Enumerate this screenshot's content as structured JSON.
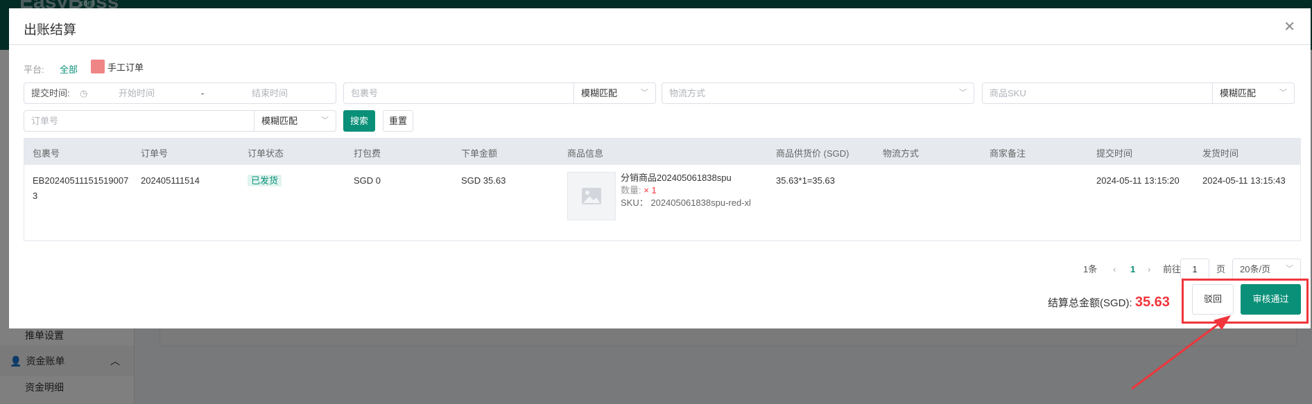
{
  "background": {
    "logo": "EasyBoss",
    "logo_suffix": ".com",
    "sidebar": [
      {
        "label": "推单设置"
      },
      {
        "label": "资金账单",
        "icon": "user-icon",
        "expanded": true
      },
      {
        "label": "资金明细"
      }
    ]
  },
  "modal": {
    "title": "出账结算",
    "close_icon": "close-icon",
    "platform": {
      "label": "平台:",
      "options": [
        "全部",
        "手工订单"
      ],
      "selected": "全部"
    },
    "filters": {
      "submit_time_label": "提交时间:",
      "start_placeholder": "开始时间",
      "range_sep": "-",
      "end_placeholder": "结束时间",
      "package_placeholder": "包裹号",
      "package_match": "模糊匹配",
      "logistics_placeholder": "物流方式",
      "sku_placeholder": "商品SKU",
      "sku_match": "模糊匹配",
      "order_placeholder": "订单号",
      "order_match": "模糊匹配",
      "search": "搜索",
      "reset": "重置"
    },
    "table": {
      "columns": [
        "包裹号",
        "订单号",
        "订单状态",
        "打包费",
        "下单金额",
        "商品信息",
        "商品供货价 (SGD)",
        "物流方式",
        "商家备注",
        "提交时间",
        "发货时间"
      ],
      "rows": [
        {
          "package_no": "EB202405111515190073",
          "order_no": "202405111514",
          "status": "已发货",
          "packing_fee": "SGD 0",
          "order_amount": "SGD 35.63",
          "product_name": "分销商品202405061838spu",
          "qty_label": "数量:",
          "qty": "× 1",
          "sku_label": "SKU：",
          "sku": "202405061838spu-red-xl",
          "supply_price": "35.63*1=35.63",
          "logistics": "",
          "remark": "",
          "submit_time": "2024-05-11 13:15:20",
          "ship_time": "2024-05-11 13:15:43"
        }
      ]
    },
    "pagination": {
      "total": "1条",
      "current": "1",
      "goto_label": "前往",
      "goto_value": "1",
      "page_suffix": "页",
      "page_size": "20条/页"
    },
    "footer": {
      "total_label": "结算总金额(SGD):",
      "total_value": "35.63",
      "reject": "驳回",
      "approve": "审核通过"
    }
  },
  "colors": {
    "accent": "#0a9078",
    "danger": "#f0353b"
  }
}
